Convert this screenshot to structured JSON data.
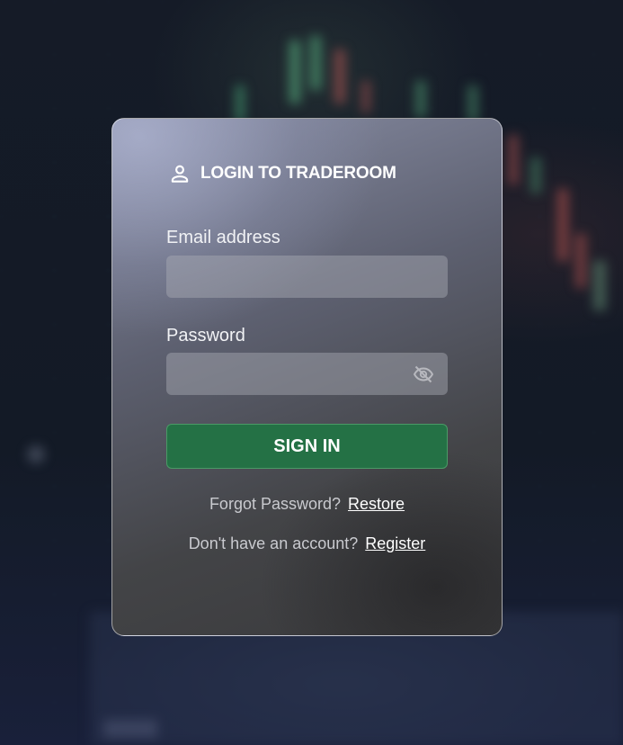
{
  "login": {
    "title": "LOGIN TO TRADEROOM",
    "title_icon": "user-icon",
    "email_label": "Email address",
    "email_value": "",
    "password_label": "Password",
    "password_value": "",
    "password_visibility_icon": "eye-off-icon",
    "signin_label": "SIGN IN",
    "forgot_text": "Forgot Password?",
    "restore_link": "Restore",
    "no_account_text": "Don't have an account?",
    "register_link": "Register"
  },
  "colors": {
    "signin_green": "#247145",
    "background": "#141a27"
  }
}
